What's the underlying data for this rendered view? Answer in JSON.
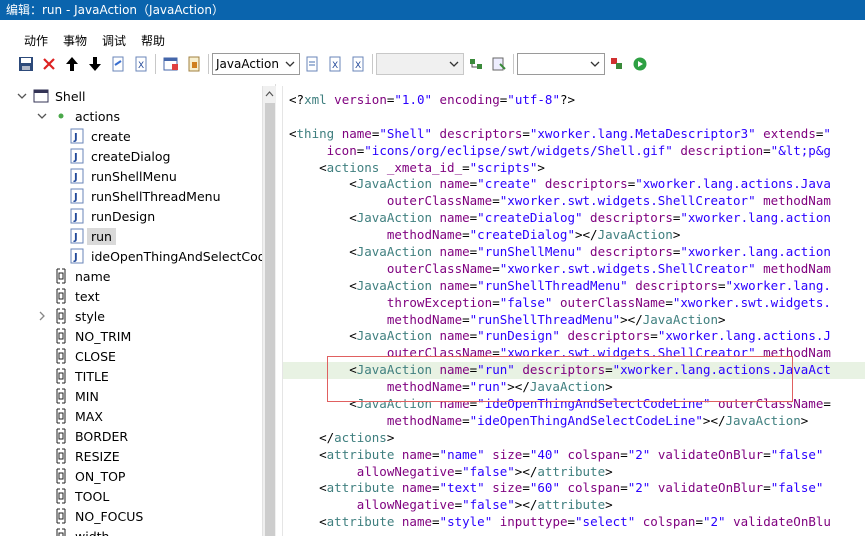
{
  "window": {
    "title": "编辑：run - JavaAction（JavaAction）"
  },
  "menu": [
    "动作",
    "事物",
    "调试",
    "帮助"
  ],
  "toolbar": {
    "combo_value": "JavaAction",
    "combo2_value": "",
    "combo3_value": ""
  },
  "tree": {
    "items": [
      {
        "label": "Shell",
        "level": 0,
        "expander": "expanded",
        "icon": "window-icon"
      },
      {
        "label": "actions",
        "level": 1,
        "expander": "expanded",
        "icon": "dot-icon"
      },
      {
        "label": "create",
        "level": 2,
        "expander": "",
        "icon": "java-icon"
      },
      {
        "label": "createDialog",
        "level": 2,
        "expander": "",
        "icon": "java-icon"
      },
      {
        "label": "runShellMenu",
        "level": 2,
        "expander": "",
        "icon": "java-icon"
      },
      {
        "label": "runShellThreadMenu",
        "level": 2,
        "expander": "",
        "icon": "java-icon"
      },
      {
        "label": "runDesign",
        "level": 2,
        "expander": "",
        "icon": "java-icon"
      },
      {
        "label": "run",
        "level": 2,
        "expander": "",
        "icon": "java-icon",
        "selected": true
      },
      {
        "label": "ideOpenThingAndSelectCodeLine",
        "level": 2,
        "expander": "",
        "icon": "java-icon"
      },
      {
        "label": "name",
        "level": 1,
        "expander": "",
        "icon": "attribute-icon"
      },
      {
        "label": "text",
        "level": 1,
        "expander": "",
        "icon": "attribute-icon"
      },
      {
        "label": "style",
        "level": 1,
        "expander": "collapsed",
        "icon": "attribute-icon"
      },
      {
        "label": "NO_TRIM",
        "level": 1,
        "expander": "",
        "icon": "attribute-icon"
      },
      {
        "label": "CLOSE",
        "level": 1,
        "expander": "",
        "icon": "attribute-icon"
      },
      {
        "label": "TITLE",
        "level": 1,
        "expander": "",
        "icon": "attribute-icon"
      },
      {
        "label": "MIN",
        "level": 1,
        "expander": "",
        "icon": "attribute-icon"
      },
      {
        "label": "MAX",
        "level": 1,
        "expander": "",
        "icon": "attribute-icon"
      },
      {
        "label": "BORDER",
        "level": 1,
        "expander": "",
        "icon": "attribute-icon"
      },
      {
        "label": "RESIZE",
        "level": 1,
        "expander": "",
        "icon": "attribute-icon"
      },
      {
        "label": "ON_TOP",
        "level": 1,
        "expander": "",
        "icon": "attribute-icon"
      },
      {
        "label": "TOOL",
        "level": 1,
        "expander": "",
        "icon": "attribute-icon"
      },
      {
        "label": "NO_FOCUS",
        "level": 1,
        "expander": "",
        "icon": "attribute-icon"
      },
      {
        "label": "width",
        "level": 1,
        "expander": "",
        "icon": "attribute-icon"
      }
    ]
  },
  "code": [
    [
      [
        "p",
        "<?"
      ],
      [
        "t",
        "xml"
      ],
      [
        "a",
        " version"
      ],
      [
        "p",
        "="
      ],
      [
        "v",
        "\"1.0\""
      ],
      [
        "a",
        " encoding"
      ],
      [
        "p",
        "="
      ],
      [
        "v",
        "\"utf-8\""
      ],
      [
        "p",
        "?>"
      ]
    ],
    [],
    [
      [
        "p",
        "<"
      ],
      [
        "t",
        "thing"
      ],
      [
        "a",
        " name"
      ],
      [
        "p",
        "="
      ],
      [
        "v",
        "\"Shell\""
      ],
      [
        "a",
        " descriptors"
      ],
      [
        "p",
        "="
      ],
      [
        "v",
        "\"xworker.lang.MetaDescriptor3\""
      ],
      [
        "a",
        " extends"
      ],
      [
        "p",
        "="
      ],
      [
        "v",
        "\""
      ]
    ],
    [
      [
        "a",
        "     icon"
      ],
      [
        "p",
        "="
      ],
      [
        "v",
        "\"icons/org/eclipse/swt/widgets/Shell.gif\""
      ],
      [
        "a",
        " description"
      ],
      [
        "p",
        "="
      ],
      [
        "v",
        "\"&lt;p&g"
      ]
    ],
    [
      [
        "p",
        "    <"
      ],
      [
        "t",
        "actions"
      ],
      [
        "a",
        " _xmeta_id_"
      ],
      [
        "p",
        "="
      ],
      [
        "v",
        "\"scripts\""
      ],
      [
        "p",
        ">"
      ]
    ],
    [
      [
        "p",
        "        <"
      ],
      [
        "t",
        "JavaAction"
      ],
      [
        "a",
        " name"
      ],
      [
        "p",
        "="
      ],
      [
        "v",
        "\"create\""
      ],
      [
        "a",
        " descriptors"
      ],
      [
        "p",
        "="
      ],
      [
        "v",
        "\"xworker.lang.actions.Java"
      ]
    ],
    [
      [
        "a",
        "             outerClassName"
      ],
      [
        "p",
        "="
      ],
      [
        "v",
        "\"xworker.swt.widgets.ShellCreator\""
      ],
      [
        "a",
        " methodNam"
      ]
    ],
    [
      [
        "p",
        "        <"
      ],
      [
        "t",
        "JavaAction"
      ],
      [
        "a",
        " name"
      ],
      [
        "p",
        "="
      ],
      [
        "v",
        "\"createDialog\""
      ],
      [
        "a",
        " descriptors"
      ],
      [
        "p",
        "="
      ],
      [
        "v",
        "\"xworker.lang.action"
      ]
    ],
    [
      [
        "a",
        "             methodName"
      ],
      [
        "p",
        "="
      ],
      [
        "v",
        "\"createDialog\""
      ],
      [
        "p",
        "></"
      ],
      [
        "t",
        "JavaAction"
      ],
      [
        "p",
        ">"
      ]
    ],
    [
      [
        "p",
        "        <"
      ],
      [
        "t",
        "JavaAction"
      ],
      [
        "a",
        " name"
      ],
      [
        "p",
        "="
      ],
      [
        "v",
        "\"runShellMenu\""
      ],
      [
        "a",
        " descriptors"
      ],
      [
        "p",
        "="
      ],
      [
        "v",
        "\"xworker.lang.action"
      ]
    ],
    [
      [
        "a",
        "             outerClassName"
      ],
      [
        "p",
        "="
      ],
      [
        "v",
        "\"xworker.swt.widgets.ShellCreator\""
      ],
      [
        "a",
        " methodNam"
      ]
    ],
    [
      [
        "p",
        "        <"
      ],
      [
        "t",
        "JavaAction"
      ],
      [
        "a",
        " name"
      ],
      [
        "p",
        "="
      ],
      [
        "v",
        "\"runShellThreadMenu\""
      ],
      [
        "a",
        " descriptors"
      ],
      [
        "p",
        "="
      ],
      [
        "v",
        "\"xworker.lang."
      ]
    ],
    [
      [
        "a",
        "             throwException"
      ],
      [
        "p",
        "="
      ],
      [
        "v",
        "\"false\""
      ],
      [
        "a",
        " outerClassName"
      ],
      [
        "p",
        "="
      ],
      [
        "v",
        "\"xworker.swt.widgets."
      ]
    ],
    [
      [
        "a",
        "             methodName"
      ],
      [
        "p",
        "="
      ],
      [
        "v",
        "\"runShellThreadMenu\""
      ],
      [
        "p",
        "></"
      ],
      [
        "t",
        "JavaAction"
      ],
      [
        "p",
        ">"
      ]
    ],
    [
      [
        "p",
        "        <"
      ],
      [
        "t",
        "JavaAction"
      ],
      [
        "a",
        " name"
      ],
      [
        "p",
        "="
      ],
      [
        "v",
        "\"runDesign\""
      ],
      [
        "a",
        " descriptors"
      ],
      [
        "p",
        "="
      ],
      [
        "v",
        "\"xworker.lang.actions.J"
      ]
    ],
    [
      [
        "a",
        "             outerClassName"
      ],
      [
        "p",
        "="
      ],
      [
        "v",
        "\"xworker.swt.widgets.ShellCreator\""
      ],
      [
        "a",
        " methodNam"
      ]
    ],
    [
      [
        "p",
        "        <"
      ],
      [
        "t",
        "JavaAction"
      ],
      [
        "a",
        " name"
      ],
      [
        "p",
        "="
      ],
      [
        "v",
        "\"run\""
      ],
      [
        "a",
        " descriptors"
      ],
      [
        "p",
        "="
      ],
      [
        "v",
        "\"xworker.lang.actions.JavaAct"
      ]
    ],
    [
      [
        "a",
        "             methodName"
      ],
      [
        "p",
        "="
      ],
      [
        "v",
        "\"run\""
      ],
      [
        "p",
        "></"
      ],
      [
        "t",
        "JavaAction"
      ],
      [
        "p",
        ">"
      ]
    ],
    [
      [
        "p",
        "        <"
      ],
      [
        "t",
        "JavaAction"
      ],
      [
        "a",
        " name"
      ],
      [
        "p",
        "="
      ],
      [
        "v",
        "\"ideOpenThingAndSelectCodeLine\""
      ],
      [
        "a",
        " outerClassName"
      ],
      [
        "p",
        "="
      ]
    ],
    [
      [
        "a",
        "             methodName"
      ],
      [
        "p",
        "="
      ],
      [
        "v",
        "\"ideOpenThingAndSelectCodeLine\""
      ],
      [
        "p",
        "></"
      ],
      [
        "t",
        "JavaAction"
      ],
      [
        "p",
        ">"
      ]
    ],
    [
      [
        "p",
        "    </"
      ],
      [
        "t",
        "actions"
      ],
      [
        "p",
        ">"
      ]
    ],
    [
      [
        "p",
        "    <"
      ],
      [
        "t",
        "attribute"
      ],
      [
        "a",
        " name"
      ],
      [
        "p",
        "="
      ],
      [
        "v",
        "\"name\""
      ],
      [
        "a",
        " size"
      ],
      [
        "p",
        "="
      ],
      [
        "v",
        "\"40\""
      ],
      [
        "a",
        " colspan"
      ],
      [
        "p",
        "="
      ],
      [
        "v",
        "\"2\""
      ],
      [
        "a",
        " validateOnBlur"
      ],
      [
        "p",
        "="
      ],
      [
        "v",
        "\"false\""
      ]
    ],
    [
      [
        "a",
        "         allowNegative"
      ],
      [
        "p",
        "="
      ],
      [
        "v",
        "\"false\""
      ],
      [
        "p",
        "></"
      ],
      [
        "t",
        "attribute"
      ],
      [
        "p",
        ">"
      ]
    ],
    [
      [
        "p",
        "    <"
      ],
      [
        "t",
        "attribute"
      ],
      [
        "a",
        " name"
      ],
      [
        "p",
        "="
      ],
      [
        "v",
        "\"text\""
      ],
      [
        "a",
        " size"
      ],
      [
        "p",
        "="
      ],
      [
        "v",
        "\"60\""
      ],
      [
        "a",
        " colspan"
      ],
      [
        "p",
        "="
      ],
      [
        "v",
        "\"2\""
      ],
      [
        "a",
        " validateOnBlur"
      ],
      [
        "p",
        "="
      ],
      [
        "v",
        "\"false\""
      ]
    ],
    [
      [
        "a",
        "         allowNegative"
      ],
      [
        "p",
        "="
      ],
      [
        "v",
        "\"false\""
      ],
      [
        "p",
        "></"
      ],
      [
        "t",
        "attribute"
      ],
      [
        "p",
        ">"
      ]
    ],
    [
      [
        "p",
        "    <"
      ],
      [
        "t",
        "attribute"
      ],
      [
        "a",
        " name"
      ],
      [
        "p",
        "="
      ],
      [
        "v",
        "\"style\""
      ],
      [
        "a",
        " inputtype"
      ],
      [
        "p",
        "="
      ],
      [
        "v",
        "\"select\""
      ],
      [
        "a",
        " colspan"
      ],
      [
        "p",
        "="
      ],
      [
        "v",
        "\"2\""
      ],
      [
        "a",
        " validateOnBlu"
      ]
    ]
  ],
  "highlighted_line": 16
}
